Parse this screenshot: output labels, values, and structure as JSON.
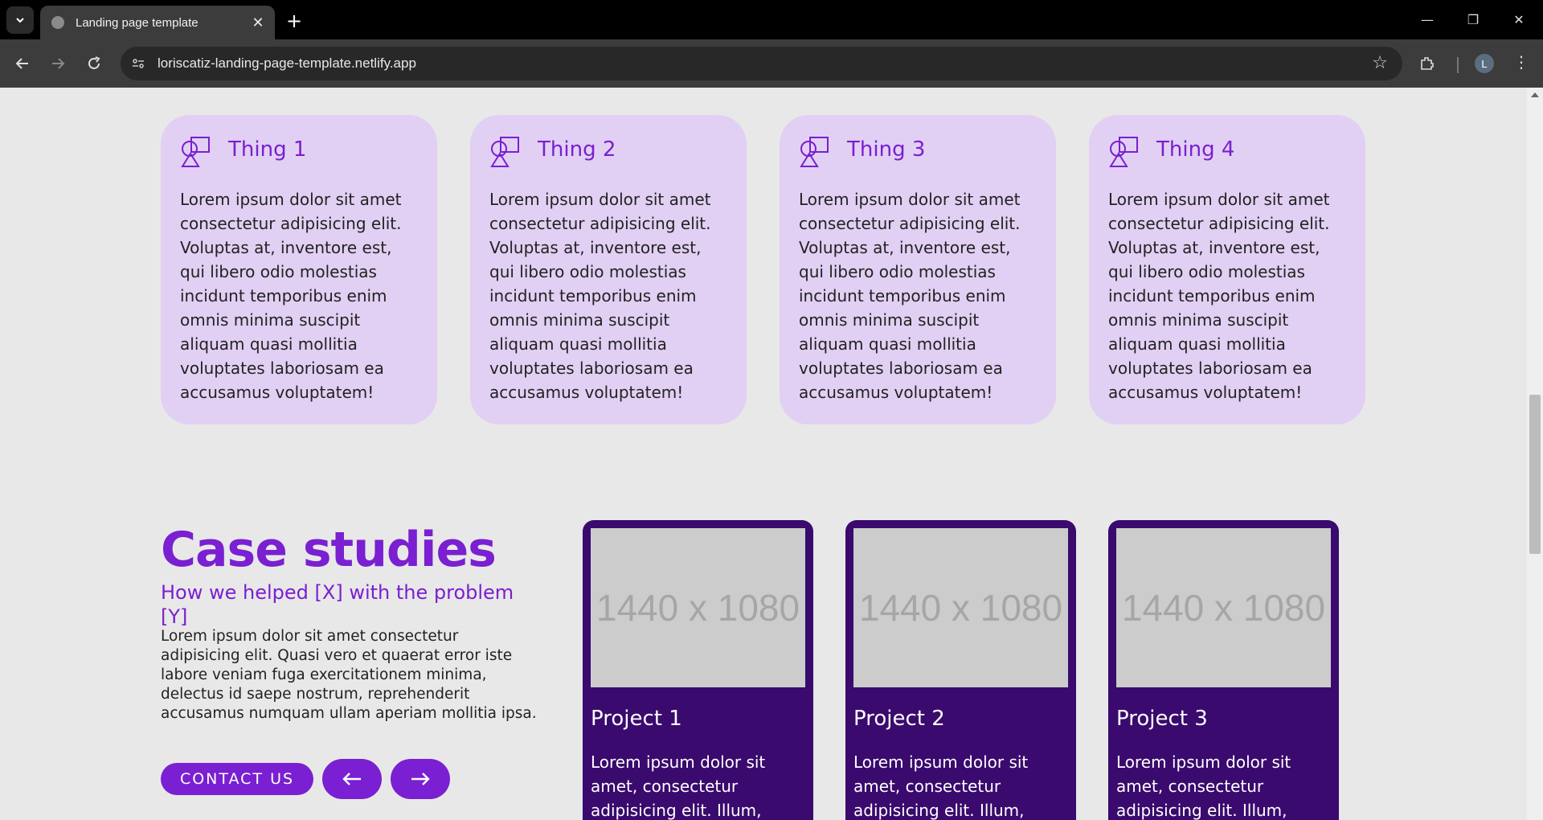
{
  "browser": {
    "tab_title": "Landing page template",
    "url": "loriscatiz-landing-page-template.netlify.app",
    "profile_initial": "L"
  },
  "things": [
    {
      "title": "Thing 1",
      "body": "Lorem ipsum dolor sit amet consectetur adipisicing elit. Voluptas at, inventore est, qui libero odio molestias incidunt temporibus enim omnis minima suscipit aliquam quasi mollitia voluptates laboriosam ea accusamus voluptatem!"
    },
    {
      "title": "Thing 2",
      "body": "Lorem ipsum dolor sit amet consectetur adipisicing elit. Voluptas at, inventore est, qui libero odio molestias incidunt temporibus enim omnis minima suscipit aliquam quasi mollitia voluptates laboriosam ea accusamus voluptatem!"
    },
    {
      "title": "Thing 3",
      "body": "Lorem ipsum dolor sit amet consectetur adipisicing elit. Voluptas at, inventore est, qui libero odio molestias incidunt temporibus enim omnis minima suscipit aliquam quasi mollitia voluptates laboriosam ea accusamus voluptatem!"
    },
    {
      "title": "Thing 4",
      "body": "Lorem ipsum dolor sit amet consectetur adipisicing elit. Voluptas at, inventore est, qui libero odio molestias incidunt temporibus enim omnis minima suscipit aliquam quasi mollitia voluptates laboriosam ea accusamus voluptatem!"
    }
  ],
  "case_studies": {
    "title": "Case studies",
    "subtitle": "How we helped [X] with the problem [Y]",
    "body": "Lorem ipsum dolor sit amet consectetur adipisicing elit. Quasi vero et quaerat error iste labore veniam fuga exercitationem minima, delectus id saepe nostrum, reprehenderit accusamus numquam ullam aperiam mollitia ipsa.",
    "contact_label": "CONTACT US",
    "prev_icon": "arrow-left-icon",
    "next_icon": "arrow-right-icon"
  },
  "projects": [
    {
      "placeholder": "1440 x 1080",
      "title": "Project 1",
      "body": "Lorem ipsum dolor sit amet, consectetur adipisicing elit. Illum,"
    },
    {
      "placeholder": "1440 x 1080",
      "title": "Project 2",
      "body": "Lorem ipsum dolor sit amet, consectetur adipisicing elit. Illum,"
    },
    {
      "placeholder": "1440 x 1080",
      "title": "Project 3",
      "body": "Lorem ipsum dolor sit amet, consectetur adipisicing elit. Illum,"
    }
  ],
  "colors": {
    "accent": "#7a1fd1",
    "card_bg": "#e1d0f3",
    "project_bg": "#3a0a6e",
    "page_bg": "#e8e8e8"
  }
}
